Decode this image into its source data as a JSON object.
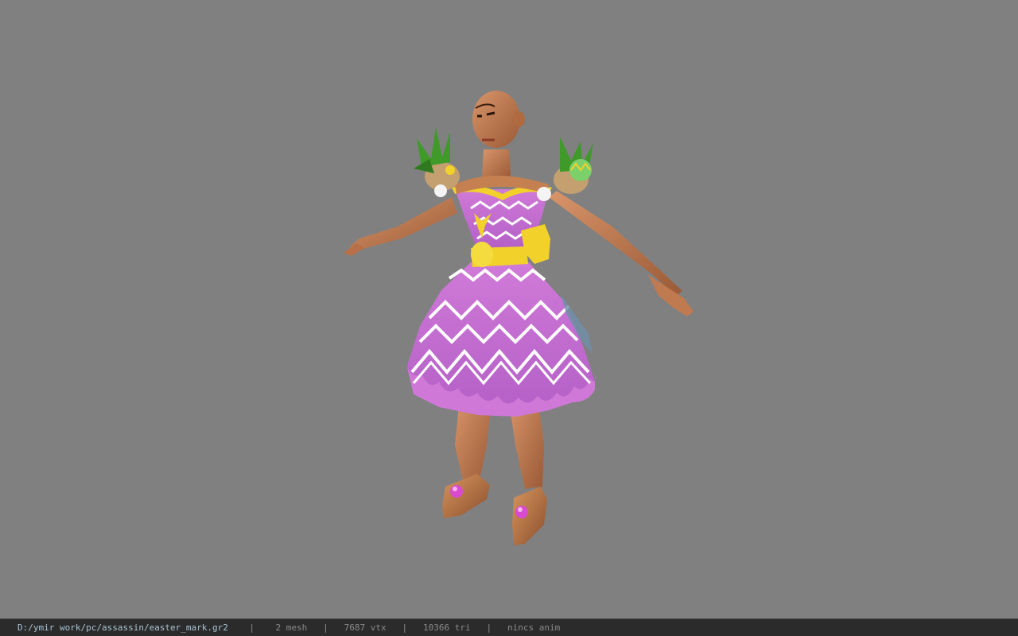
{
  "viewport": {
    "background": "#808080",
    "model_name": "easter_mark"
  },
  "status": {
    "path": "D:/ymir work/pc/assassin/easter_mark.gr2",
    "mesh": "2 mesh",
    "vtx": "7687 vtx",
    "tri": "10366 tri",
    "anim": "nincs anim",
    "separator": "|"
  },
  "colors": {
    "skin": "#c8845a",
    "dress": "#c46fd0",
    "trim": "#f2d22a",
    "statusbar_bg": "#2b2b2b",
    "path_text": "#a9c4d6"
  }
}
